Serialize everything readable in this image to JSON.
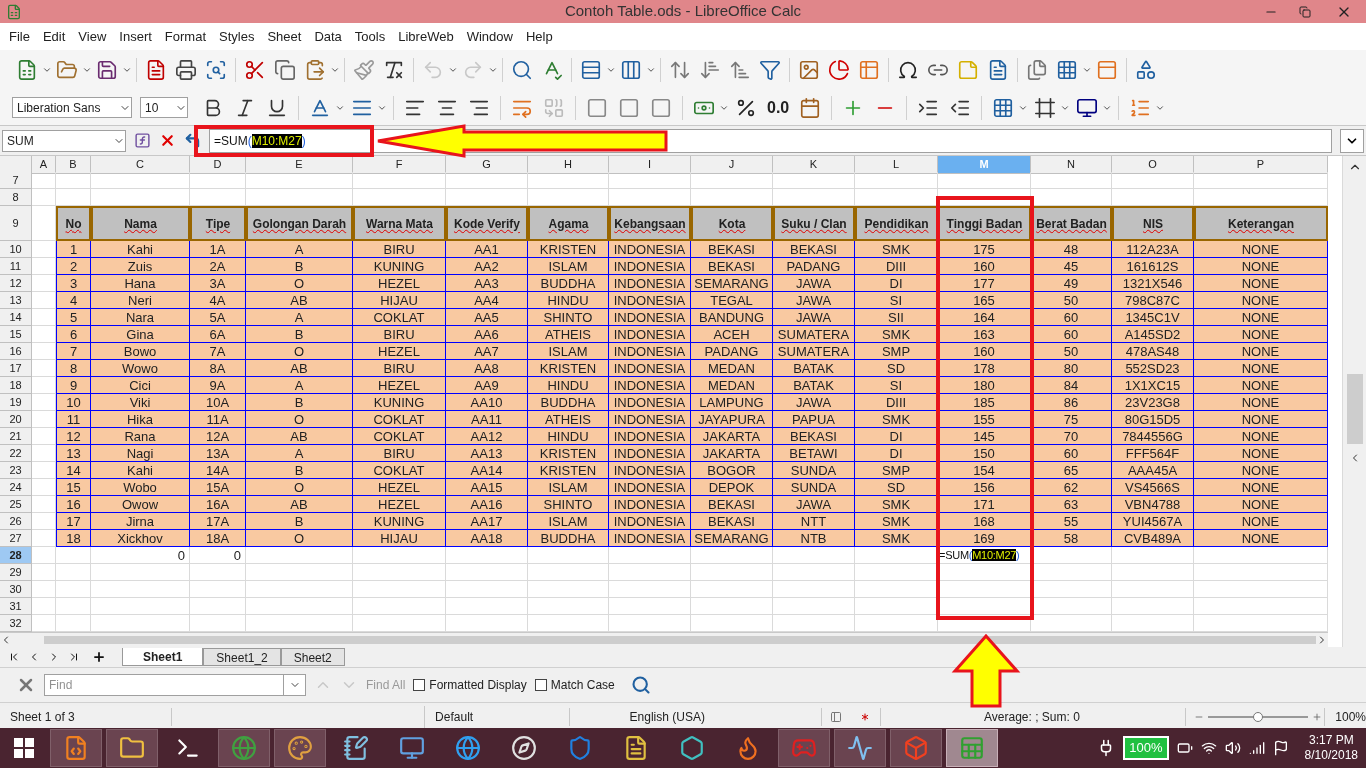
{
  "window": {
    "title": "Contoh Table.ods - LibreOffice Calc"
  },
  "menu": [
    "File",
    "Edit",
    "View",
    "Insert",
    "Format",
    "Styles",
    "Sheet",
    "Data",
    "Tools",
    "LibreWeb",
    "Window",
    "Help"
  ],
  "format_bar": {
    "font": "Liberation Sans",
    "size": "10",
    "number_format": "0.0"
  },
  "formula_bar": {
    "name_box": "SUM",
    "formula": [
      {
        "text": "=SUM",
        "kind": "function"
      },
      {
        "text": "(",
        "kind": "bracket"
      },
      {
        "text": "M10:M27",
        "kind": "range"
      },
      {
        "text": ")",
        "kind": "bracket"
      }
    ]
  },
  "sheet": {
    "columns": [
      {
        "label": "A",
        "selected": false
      },
      {
        "label": "B",
        "selected": false
      },
      {
        "label": "C",
        "selected": false
      },
      {
        "label": "D",
        "selected": false
      },
      {
        "label": "E",
        "selected": false
      },
      {
        "label": "F",
        "selected": false
      },
      {
        "label": "G",
        "selected": false
      },
      {
        "label": "H",
        "selected": false
      },
      {
        "label": "I",
        "selected": false
      },
      {
        "label": "J",
        "selected": false
      },
      {
        "label": "K",
        "selected": false
      },
      {
        "label": "L",
        "selected": false
      },
      {
        "label": "M",
        "selected": true
      },
      {
        "label": "N",
        "selected": false
      },
      {
        "label": "O",
        "selected": false
      },
      {
        "label": "P",
        "selected": false
      }
    ],
    "row_numbers": [
      {
        "label": "7",
        "selected": false
      },
      {
        "label": "8",
        "selected": false
      },
      {
        "label": "9",
        "selected": false
      },
      {
        "label": "10",
        "selected": false
      },
      {
        "label": "11",
        "selected": false
      },
      {
        "label": "12",
        "selected": false
      },
      {
        "label": "13",
        "selected": false
      },
      {
        "label": "14",
        "selected": false
      },
      {
        "label": "15",
        "selected": false
      },
      {
        "label": "16",
        "selected": false
      },
      {
        "label": "17",
        "selected": false
      },
      {
        "label": "18",
        "selected": false
      },
      {
        "label": "19",
        "selected": false
      },
      {
        "label": "20",
        "selected": false
      },
      {
        "label": "21",
        "selected": false
      },
      {
        "label": "22",
        "selected": false
      },
      {
        "label": "23",
        "selected": false
      },
      {
        "label": "24",
        "selected": false
      },
      {
        "label": "25",
        "selected": false
      },
      {
        "label": "26",
        "selected": false
      },
      {
        "label": "27",
        "selected": false
      },
      {
        "label": "28",
        "selected": true
      },
      {
        "label": "29",
        "selected": false
      },
      {
        "label": "30",
        "selected": false
      },
      {
        "label": "31",
        "selected": false
      },
      {
        "label": "32",
        "selected": false
      }
    ],
    "header": [
      "No",
      "Nama",
      "Tipe",
      "Golongan Darah",
      "Warna Mata",
      "Kode Verify",
      "Agama",
      "Kebangsaan",
      "Kota",
      "Suku / Clan",
      "Pendidikan",
      "Tinggi Badan",
      "Berat Badan",
      "NIS",
      "Keterangan"
    ],
    "rows": [
      [
        "",
        "1",
        "Kahi",
        "1A",
        "A",
        "BIRU",
        "AA1",
        "KRISTEN",
        "INDONESIA",
        "BEKASI",
        "BEKASI",
        "SMK",
        "175",
        "48",
        "112A23A",
        "NONE"
      ],
      [
        "",
        "2",
        "Zuis",
        "2A",
        "B",
        "KUNING",
        "AA2",
        "ISLAM",
        "INDONESIA",
        "BEKASI",
        "PADANG",
        "DIII",
        "160",
        "45",
        "161612S",
        "NONE"
      ],
      [
        "",
        "3",
        "Hana",
        "3A",
        "O",
        "HEZEL",
        "AA3",
        "BUDDHA",
        "INDONESIA",
        "SEMARANG",
        "JAWA",
        "DI",
        "177",
        "49",
        "1321X546",
        "NONE"
      ],
      [
        "",
        "4",
        "Neri",
        "4A",
        "AB",
        "HIJAU",
        "AA4",
        "HINDU",
        "INDONESIA",
        "TEGAL",
        "JAWA",
        "SI",
        "165",
        "50",
        "798C87C",
        "NONE"
      ],
      [
        "",
        "5",
        "Nara",
        "5A",
        "A",
        "COKLAT",
        "AA5",
        "SHINTO",
        "INDONESIA",
        "BANDUNG",
        "JAWA",
        "SII",
        "164",
        "60",
        "1345C1V",
        "NONE"
      ],
      [
        "",
        "6",
        "Gina",
        "6A",
        "B",
        "BIRU",
        "AA6",
        "ATHEIS",
        "INDONESIA",
        "ACEH",
        "SUMATERA",
        "SMK",
        "163",
        "60",
        "A145SD2",
        "NONE"
      ],
      [
        "",
        "7",
        "Bowo",
        "7A",
        "O",
        "HEZEL",
        "AA7",
        "ISLAM",
        "INDONESIA",
        "PADANG",
        "SUMATERA",
        "SMP",
        "160",
        "50",
        "478AS48",
        "NONE"
      ],
      [
        "",
        "8",
        "Wowo",
        "8A",
        "AB",
        "BIRU",
        "AA8",
        "KRISTEN",
        "INDONESIA",
        "MEDAN",
        "BATAK",
        "SD",
        "178",
        "80",
        "552SD23",
        "NONE"
      ],
      [
        "",
        "9",
        "Cici",
        "9A",
        "A",
        "HEZEL",
        "AA9",
        "HINDU",
        "INDONESIA",
        "MEDAN",
        "BATAK",
        "SI",
        "180",
        "84",
        "1X1XC15",
        "NONE"
      ],
      [
        "",
        "10",
        "Viki",
        "10A",
        "B",
        "KUNING",
        "AA10",
        "BUDDHA",
        "INDONESIA",
        "LAMPUNG",
        "JAWA",
        "DIII",
        "185",
        "86",
        "23V23G8",
        "NONE"
      ],
      [
        "",
        "11",
        "Hika",
        "11A",
        "O",
        "COKLAT",
        "AA11",
        "ATHEIS",
        "INDONESIA",
        "JAYAPURA",
        "PAPUA",
        "SMK",
        "155",
        "75",
        "80G15D5",
        "NONE"
      ],
      [
        "",
        "12",
        "Rana",
        "12A",
        "AB",
        "COKLAT",
        "AA12",
        "HINDU",
        "INDONESIA",
        "JAKARTA",
        "BEKASI",
        "DI",
        "145",
        "70",
        "7844556G",
        "NONE"
      ],
      [
        "",
        "13",
        "Nagi",
        "13A",
        "A",
        "BIRU",
        "AA13",
        "KRISTEN",
        "INDONESIA",
        "JAKARTA",
        "BETAWI",
        "DI",
        "150",
        "60",
        "FFF564F",
        "NONE"
      ],
      [
        "",
        "14",
        "Kahi",
        "14A",
        "B",
        "COKLAT",
        "AA14",
        "KRISTEN",
        "INDONESIA",
        "BOGOR",
        "SUNDA",
        "SMP",
        "154",
        "65",
        "AAA45A",
        "NONE"
      ],
      [
        "",
        "15",
        "Wobo",
        "15A",
        "O",
        "HEZEL",
        "AA15",
        "ISLAM",
        "INDONESIA",
        "DEPOK",
        "SUNDA",
        "SD",
        "156",
        "62",
        "VS4566S",
        "NONE"
      ],
      [
        "",
        "16",
        "Owow",
        "16A",
        "AB",
        "HEZEL",
        "AA16",
        "SHINTO",
        "INDONESIA",
        "BEKASI",
        "JAWA",
        "SMK",
        "171",
        "63",
        "VBN4788",
        "NONE"
      ],
      [
        "",
        "17",
        "Jirna",
        "17A",
        "B",
        "KUNING",
        "AA17",
        "ISLAM",
        "INDONESIA",
        "BEKASI",
        "NTT",
        "SMK",
        "168",
        "55",
        "YUI4567A",
        "NONE"
      ],
      [
        "",
        "18",
        "Xickhov",
        "18A",
        "O",
        "HIJAU",
        "AA18",
        "BUDDHA",
        "INDONESIA",
        "SEMARANG",
        "NTB",
        "SMK",
        "169",
        "58",
        "CVB489A",
        "NONE"
      ]
    ],
    "total_row": {
      "c": "0",
      "d": "0",
      "m": [
        {
          "text": "=SUM",
          "kind": "function"
        },
        {
          "text": "(",
          "kind": "bracket"
        },
        {
          "text": "M10:M27",
          "kind": "range"
        },
        {
          "text": ")",
          "kind": "bracket"
        }
      ]
    }
  },
  "sheet_tabs": [
    {
      "label": "Sheet1",
      "selected": true
    },
    {
      "label": "Sheet1_2",
      "selected": false
    },
    {
      "label": "Sheet2",
      "selected": false
    }
  ],
  "find_bar": {
    "placeholder": "Find",
    "find_all": {
      "label": "Find All",
      "disabled": true
    },
    "options": [
      {
        "label": "Formatted Display",
        "checked": false
      },
      {
        "label": "Match Case",
        "checked": false
      }
    ]
  },
  "status_bar": {
    "sheet": "Sheet 1 of 3",
    "page_style": "Default",
    "language": "English (USA)",
    "summary": "Average: ; Sum: 0",
    "zoom": {
      "level": 0.5,
      "reading": "100%"
    }
  },
  "taskbar": {
    "apps": [
      {
        "kind": "editor",
        "running": true
      },
      {
        "kind": "folder",
        "running": true
      },
      {
        "kind": "terminal",
        "running": false
      },
      {
        "kind": "browser",
        "running": true
      },
      {
        "kind": "paint",
        "running": true
      },
      {
        "kind": "notepad",
        "running": false
      },
      {
        "kind": "remote",
        "running": false
      },
      {
        "kind": "ie",
        "running": false
      },
      {
        "kind": "compass",
        "running": false
      },
      {
        "kind": "shield",
        "running": false
      },
      {
        "kind": "python",
        "running": false
      },
      {
        "kind": "hexagon",
        "running": false
      },
      {
        "kind": "firefox",
        "running": false
      },
      {
        "kind": "game",
        "running": true
      },
      {
        "kind": "monitor",
        "running": true
      },
      {
        "kind": "fire",
        "running": true
      },
      {
        "kind": "calc",
        "running": true
      }
    ],
    "battery": "100%",
    "time": "3:17 PM",
    "date": "8/10/2018"
  }
}
